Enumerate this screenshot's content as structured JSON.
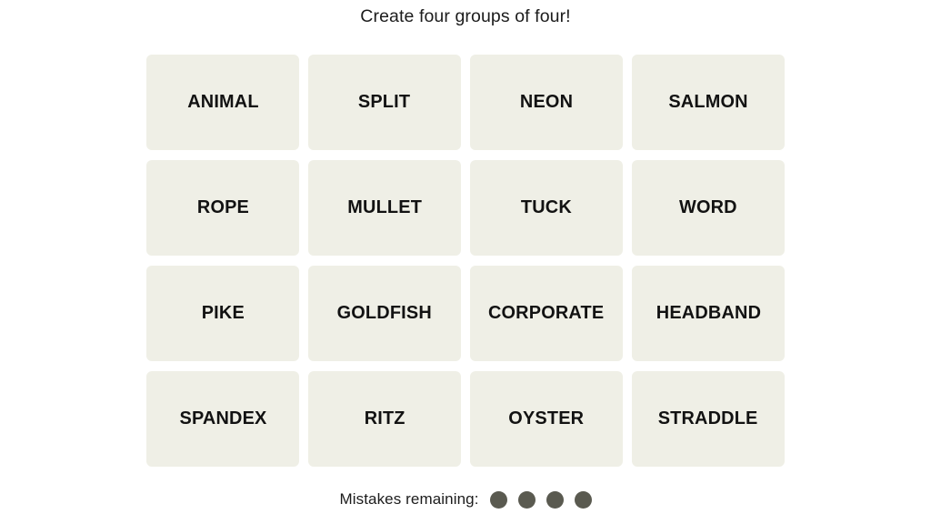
{
  "game": {
    "title": "Create four groups of four!",
    "tile_background": "#EFEFE6",
    "page_background": "#FFFFFF",
    "tile_text_color": "#121212",
    "mistake_dot_color": "#5A5A50"
  },
  "board": {
    "rows": 4,
    "columns": 4,
    "tiles": [
      {
        "label": "ANIMAL"
      },
      {
        "label": "SPLIT"
      },
      {
        "label": "NEON"
      },
      {
        "label": "SALMON"
      },
      {
        "label": "ROPE"
      },
      {
        "label": "MULLET"
      },
      {
        "label": "TUCK"
      },
      {
        "label": "WORD"
      },
      {
        "label": "PIKE"
      },
      {
        "label": "GOLDFISH"
      },
      {
        "label": "CORPORATE"
      },
      {
        "label": "HEADBAND"
      },
      {
        "label": "SPANDEX"
      },
      {
        "label": "RITZ"
      },
      {
        "label": "OYSTER"
      },
      {
        "label": "STRADDLE"
      }
    ]
  },
  "footer": {
    "mistakes_label": "Mistakes remaining:",
    "mistakes_remaining": 4,
    "dots": [
      1,
      2,
      3,
      4
    ]
  }
}
